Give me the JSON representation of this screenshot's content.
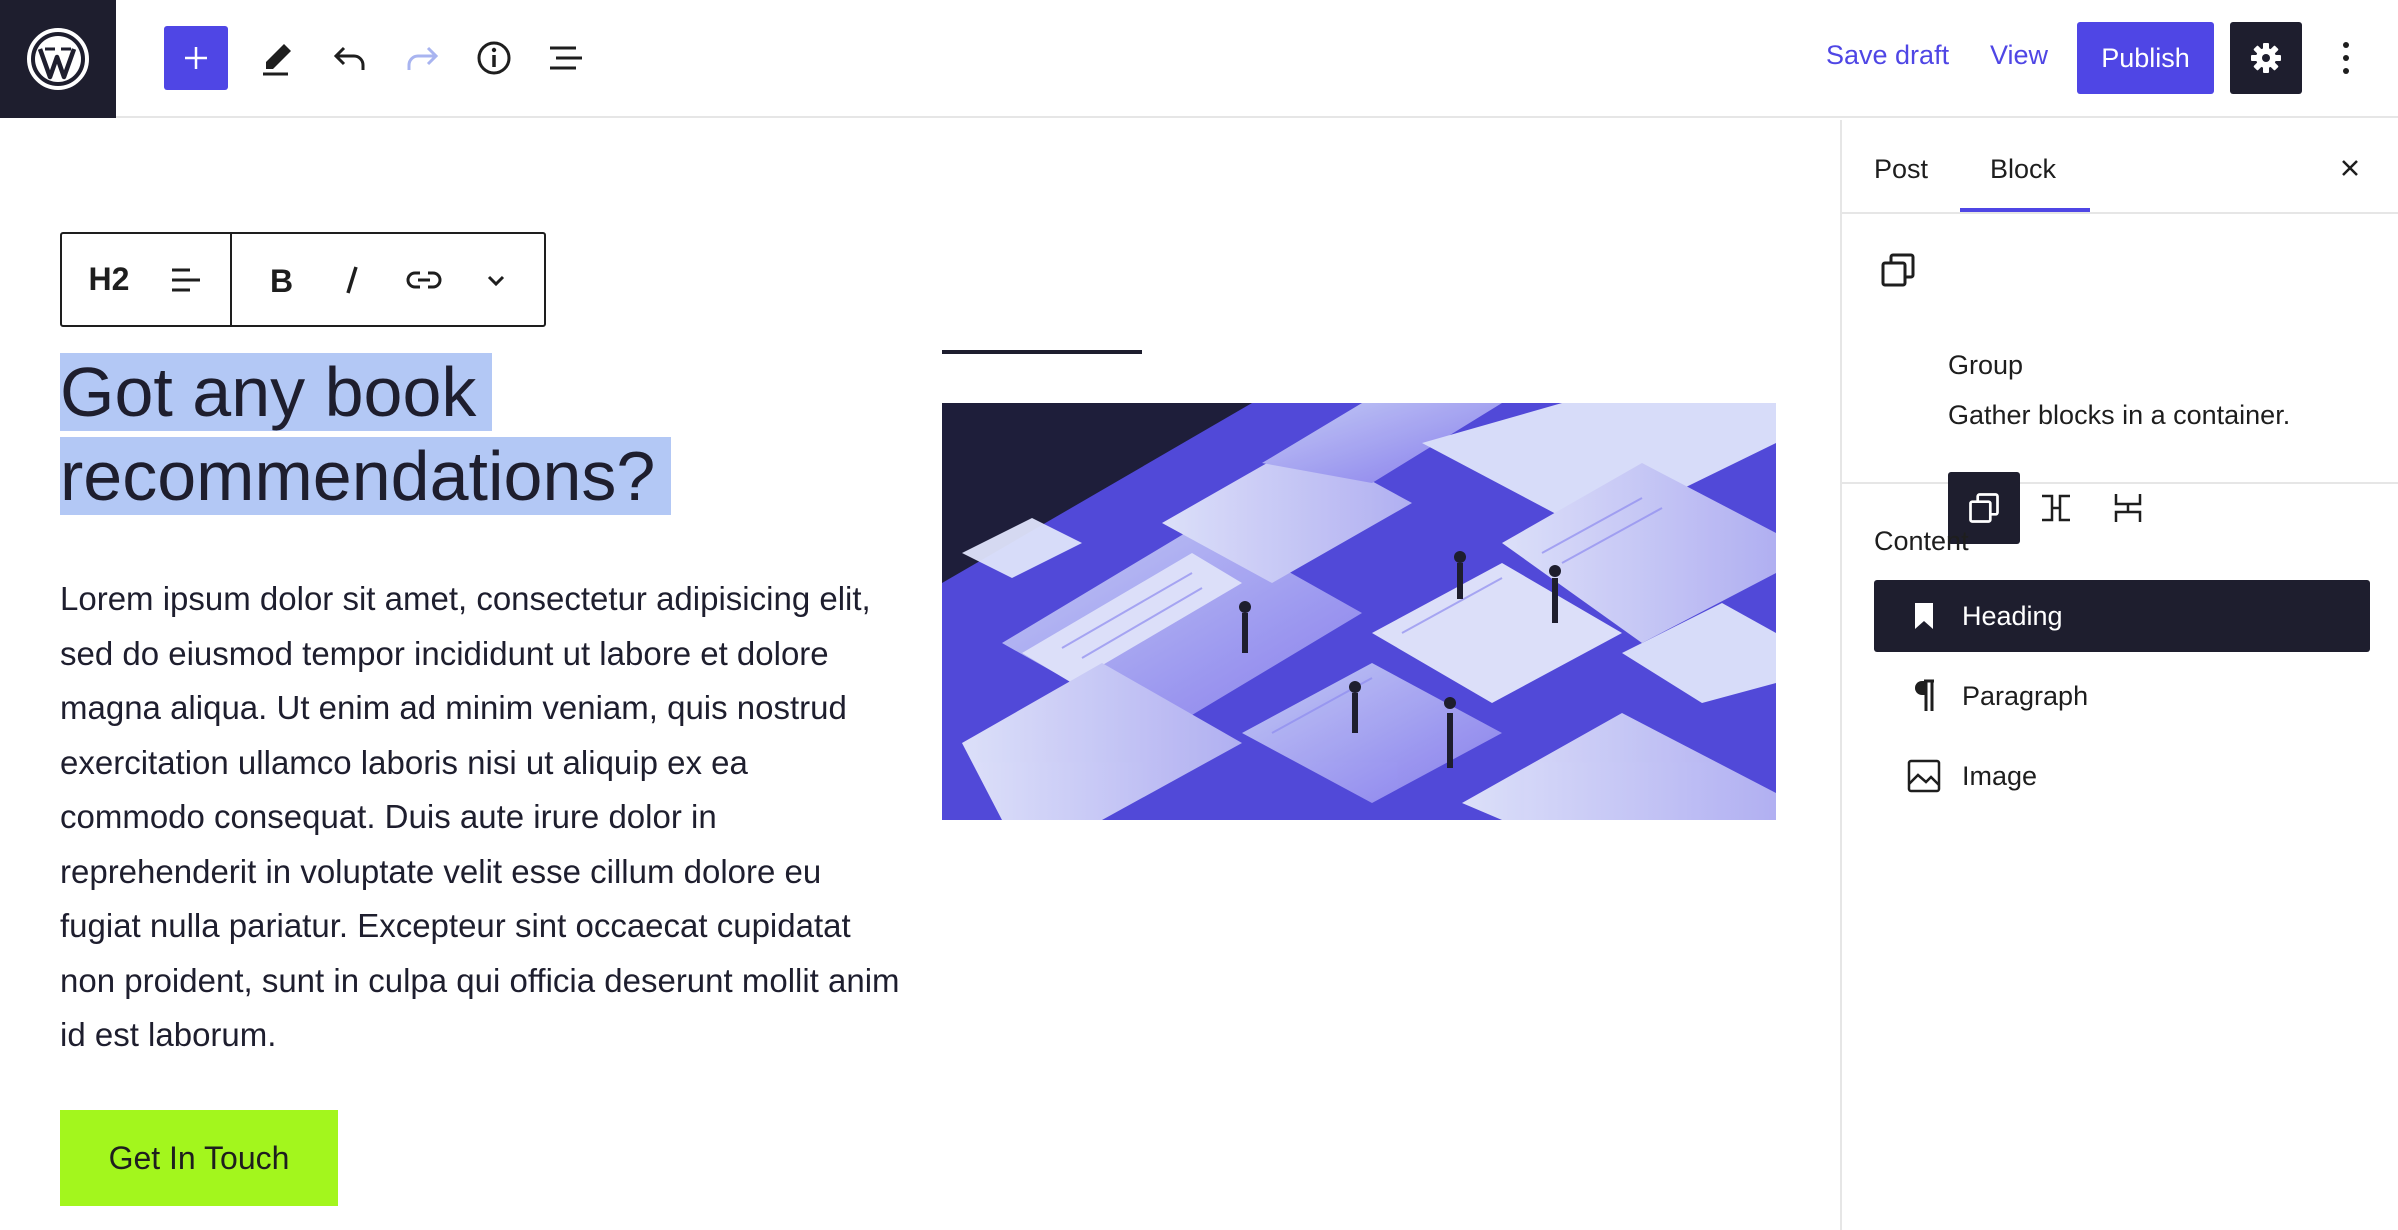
{
  "topbar": {
    "save_draft_label": "Save draft",
    "view_label": "View",
    "publish_label": "Publish",
    "icons": [
      "wordpress-logo",
      "plus-icon",
      "pencil-icon",
      "undo-icon",
      "redo-icon",
      "info-icon",
      "list-view-icon",
      "gear-icon",
      "more-vertical-icon"
    ]
  },
  "block_toolbar": {
    "heading_level": "H2",
    "icons": [
      "align-icon",
      "bold-icon",
      "italic-icon",
      "link-icon",
      "chevron-down-icon"
    ]
  },
  "content": {
    "heading": "Got any book recommendations?",
    "paragraph": "Lorem ipsum dolor sit amet, consectetur adipisicing elit, sed do eiusmod tempor incididunt ut labore et dolore magna aliqua. Ut enim ad minim veniam, quis nostrud exercitation ullamco laboris nisi ut aliquip ex ea commodo consequat. Duis aute irure dolor in reprehenderit in voluptate velit esse cillum dolore eu fugiat nulla pariatur. Excepteur sint occaecat cupidatat non proident, sunt in culpa qui officia deserunt mollit anim id est laborum.",
    "button_label": "Get In Touch"
  },
  "sidebar": {
    "tabs": [
      {
        "label": "Post"
      },
      {
        "label": "Block"
      }
    ],
    "active_tab": "Block",
    "block": {
      "name": "Group",
      "description": "Gather blocks in a container."
    },
    "content_label": "Content",
    "content_items": [
      {
        "label": "Heading",
        "icon": "bookmark-icon",
        "active": true
      },
      {
        "label": "Paragraph",
        "icon": "pilcrow-icon",
        "active": false
      },
      {
        "label": "Image",
        "icon": "image-icon",
        "active": false
      }
    ]
  },
  "colors": {
    "accent": "#4f46e5",
    "dark": "#1e1e2e",
    "selection": "#b3c8f5",
    "cta": "#a3f61d"
  }
}
